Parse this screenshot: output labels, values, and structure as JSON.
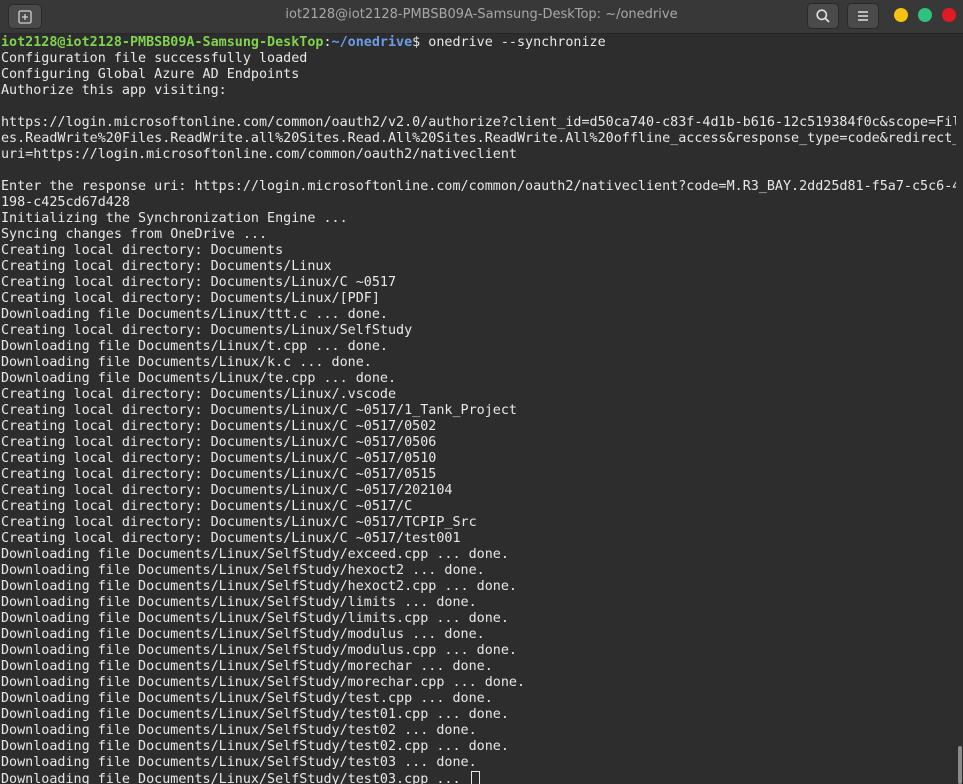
{
  "window": {
    "title": "iot2128@iot2128-PMBSB09A-Samsung-DeskTop: ~/onedrive",
    "colors": {
      "background": "#2d2d2d",
      "prompt_user": "#7fd34e",
      "prompt_path": "#6a9ce8",
      "text": "#e8e8e8"
    }
  },
  "icons": {
    "new_tab": "new-tab-icon",
    "search": "search-icon",
    "menu": "hamburger-menu-icon"
  },
  "prompt": {
    "user_host": "iot2128@iot2128-PMBSB09A-Samsung-DeskTop",
    "separator": ":",
    "path": "~/onedrive",
    "symbol": "$ ",
    "command": "onedrive --synchronize"
  },
  "output_lines": [
    "Configuration file successfully loaded",
    "Configuring Global Azure AD Endpoints",
    "Authorize this app visiting:",
    "",
    "https://login.microsoftonline.com/common/oauth2/v2.0/authorize?client_id=d50ca740-c83f-4d1b-b616-12c519384f0c&scope=Fil",
    "es.ReadWrite%20Files.ReadWrite.all%20Sites.Read.All%20Sites.ReadWrite.All%20offline_access&response_type=code&redirect_",
    "uri=https://login.microsoftonline.com/common/oauth2/nativeclient",
    "",
    "Enter the response uri: https://login.microsoftonline.com/common/oauth2/nativeclient?code=M.R3_BAY.2dd25d81-f5a7-c5c6-4",
    "198-c425cd67d428",
    "Initializing the Synchronization Engine ...",
    "Syncing changes from OneDrive ...",
    "Creating local directory: Documents",
    "Creating local directory: Documents/Linux",
    "Creating local directory: Documents/Linux/C ~0517",
    "Creating local directory: Documents/Linux/[PDF]",
    "Downloading file Documents/Linux/ttt.c ... done.",
    "Creating local directory: Documents/Linux/SelfStudy",
    "Downloading file Documents/Linux/t.cpp ... done.",
    "Downloading file Documents/Linux/k.c ... done.",
    "Downloading file Documents/Linux/te.cpp ... done.",
    "Creating local directory: Documents/Linux/.vscode",
    "Creating local directory: Documents/Linux/C ~0517/1_Tank_Project",
    "Creating local directory: Documents/Linux/C ~0517/0502",
    "Creating local directory: Documents/Linux/C ~0517/0506",
    "Creating local directory: Documents/Linux/C ~0517/0510",
    "Creating local directory: Documents/Linux/C ~0517/0515",
    "Creating local directory: Documents/Linux/C ~0517/202104",
    "Creating local directory: Documents/Linux/C ~0517/C",
    "Creating local directory: Documents/Linux/C ~0517/TCPIP_Src",
    "Creating local directory: Documents/Linux/C ~0517/test001",
    "Downloading file Documents/Linux/SelfStudy/exceed.cpp ... done.",
    "Downloading file Documents/Linux/SelfStudy/hexoct2 ... done.",
    "Downloading file Documents/Linux/SelfStudy/hexoct2.cpp ... done.",
    "Downloading file Documents/Linux/SelfStudy/limits ... done.",
    "Downloading file Documents/Linux/SelfStudy/limits.cpp ... done.",
    "Downloading file Documents/Linux/SelfStudy/modulus ... done.",
    "Downloading file Documents/Linux/SelfStudy/modulus.cpp ... done.",
    "Downloading file Documents/Linux/SelfStudy/morechar ... done.",
    "Downloading file Documents/Linux/SelfStudy/morechar.cpp ... done.",
    "Downloading file Documents/Linux/SelfStudy/test.cpp ... done.",
    "Downloading file Documents/Linux/SelfStudy/test01.cpp ... done.",
    "Downloading file Documents/Linux/SelfStudy/test02 ... done.",
    "Downloading file Documents/Linux/SelfStudy/test02.cpp ... done.",
    "Downloading file Documents/Linux/SelfStudy/test03 ... done.",
    "Downloading file Documents/Linux/SelfStudy/test03.cpp ... "
  ]
}
